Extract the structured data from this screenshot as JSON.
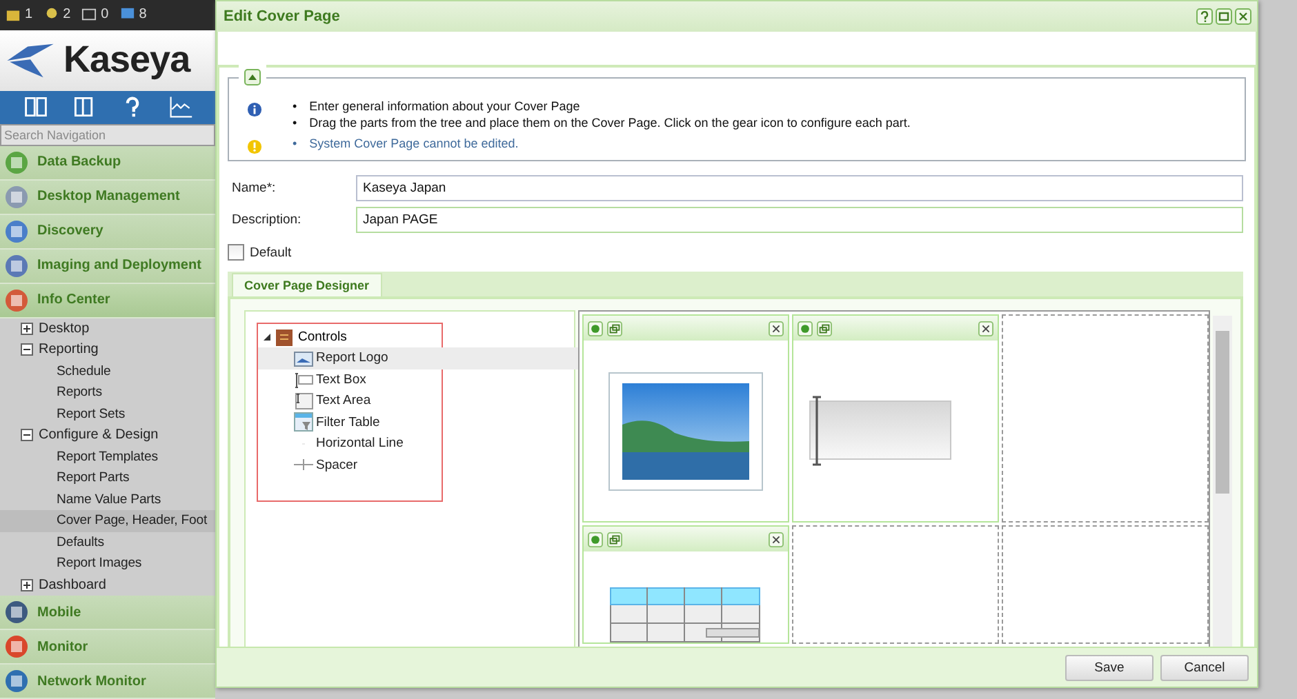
{
  "top_bar": {
    "counters": [
      {
        "count": "1"
      },
      {
        "count": "2"
      },
      {
        "count": "0"
      },
      {
        "count": "8"
      }
    ]
  },
  "logo": {
    "text": "Kaseya"
  },
  "search": {
    "placeholder": "Search Navigation"
  },
  "navigation": [
    {
      "label": "Data Backup",
      "expanded": false
    },
    {
      "label": "Desktop Management",
      "expanded": false
    },
    {
      "label": "Discovery",
      "expanded": false
    },
    {
      "label": "Imaging and Deployment",
      "expanded": false
    },
    {
      "label": "Info Center",
      "expanded": true,
      "children": [
        {
          "label": "Desktop",
          "expanded": false
        },
        {
          "label": "Reporting",
          "expanded": true,
          "children": [
            {
              "label": "Schedule",
              "selected": false
            },
            {
              "label": "Reports",
              "selected": false
            },
            {
              "label": "Report Sets",
              "selected": false
            }
          ]
        },
        {
          "label": "Configure & Design",
          "expanded": true,
          "children": [
            {
              "label": "Report Templates",
              "selected": false
            },
            {
              "label": "Report Parts",
              "selected": false
            },
            {
              "label": "Name Value Parts",
              "selected": false
            },
            {
              "label": "Cover Page, Header, Foot",
              "selected": true
            },
            {
              "label": "Defaults",
              "selected": false
            },
            {
              "label": "Report Images",
              "selected": false
            }
          ]
        },
        {
          "label": "Dashboard",
          "expanded": false
        }
      ]
    },
    {
      "label": "Mobile",
      "expanded": false
    },
    {
      "label": "Monitor",
      "expanded": false
    },
    {
      "label": "Network Monitor",
      "expanded": false
    }
  ],
  "dialog": {
    "title": "Edit Cover Page",
    "info": {
      "expanded": true,
      "notes": [
        {
          "bullet": "•",
          "text": "Enter general information about your Cover Page"
        },
        {
          "bullet": "•",
          "text": "Drag the parts from the tree and place them on the Cover Page. Click on the gear icon to configure each part."
        }
      ],
      "warning": {
        "bullet": "•",
        "text": "System Cover Page cannot be edited."
      }
    },
    "fields": [
      {
        "label": "Name*:",
        "value": "Kaseya Japan"
      },
      {
        "label": "Description:",
        "value": "Japan PAGE"
      }
    ],
    "default": {
      "label": "Default",
      "checked": false
    },
    "tabs": [
      {
        "label": "Cover Page Designer",
        "selected": true
      }
    ],
    "tree": {
      "label": "Controls",
      "expanded": true,
      "children": [
        {
          "label": "Report Logo",
          "kind": "image",
          "selected": true
        },
        {
          "label": "Text Box",
          "kind": "textbox",
          "selected": false
        },
        {
          "label": "Text Area",
          "kind": "textarea",
          "selected": false
        },
        {
          "label": "Filter Table",
          "kind": "table",
          "selected": false
        },
        {
          "label": "Horizontal Line",
          "kind": "line",
          "selected": false
        },
        {
          "label": "Spacer",
          "kind": "spacer",
          "selected": false
        }
      ]
    },
    "cells": [
      {
        "kind": "logo"
      },
      {
        "kind": "textbox"
      },
      {
        "kind": "empty"
      },
      {
        "kind": "table"
      },
      {
        "kind": "empty"
      },
      {
        "kind": "empty"
      }
    ],
    "buttons": [
      {
        "label": "Save"
      },
      {
        "label": "Cancel"
      }
    ]
  }
}
